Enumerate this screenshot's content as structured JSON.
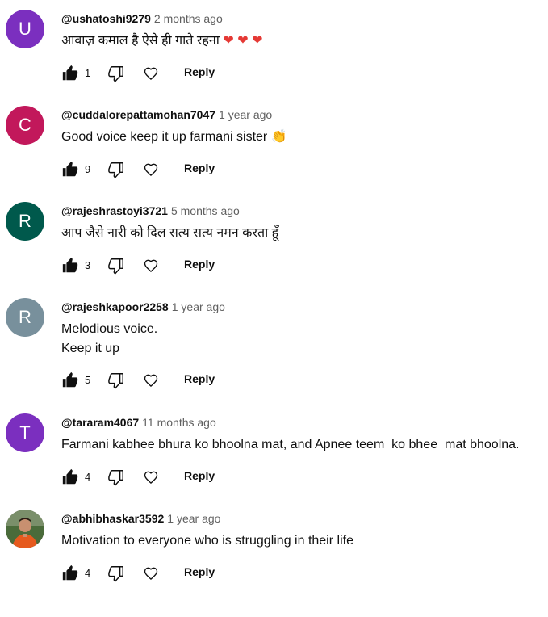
{
  "comments": [
    {
      "avatar_letter": "U",
      "avatar_color": "#7b2fbf",
      "author": "@ushatoshi9279",
      "time": "2 months ago",
      "text": "आवाज़ कमाल है ऐसे ही गाते रहना",
      "emoji": "❤ ❤ ❤",
      "likes": "1",
      "reply_label": "Reply"
    },
    {
      "avatar_letter": "C",
      "avatar_color": "#c2185b",
      "author": "@cuddalorepattamohan7047",
      "time": "1 year ago",
      "text": "Good voice keep it up farmani sister",
      "emoji": "👏",
      "likes": "9",
      "reply_label": "Reply"
    },
    {
      "avatar_letter": "R",
      "avatar_color": "#00594c",
      "author": "@rajeshrastoyi3721",
      "time": "5 months ago",
      "text": "आप जैसे नारी को दिल सत्य सत्य नमन करता हूँ",
      "emoji": "",
      "likes": "3",
      "reply_label": "Reply"
    },
    {
      "avatar_letter": "R",
      "avatar_color": "#78909c",
      "author": "@rajeshkapoor2258",
      "time": "1 year ago",
      "text": "Melodious voice.\nKeep it up",
      "emoji": "",
      "likes": "5",
      "reply_label": "Reply"
    },
    {
      "avatar_letter": "T",
      "avatar_color": "#7b2fbf",
      "author": "@tararam4067",
      "time": "11 months ago",
      "text": "Farmani kabhee bhura ko bhoolna mat, and Apnee teem  ko bhee  mat bhoolna.",
      "emoji": "",
      "likes": "4",
      "reply_label": "Reply"
    },
    {
      "avatar_letter": "",
      "avatar_color": "#2e7d32",
      "author": "@abhibhaskar3592",
      "time": "1 year ago",
      "text": "Motivation to everyone who is struggling in their life",
      "emoji": "",
      "likes": "4",
      "reply_label": "Reply"
    }
  ]
}
